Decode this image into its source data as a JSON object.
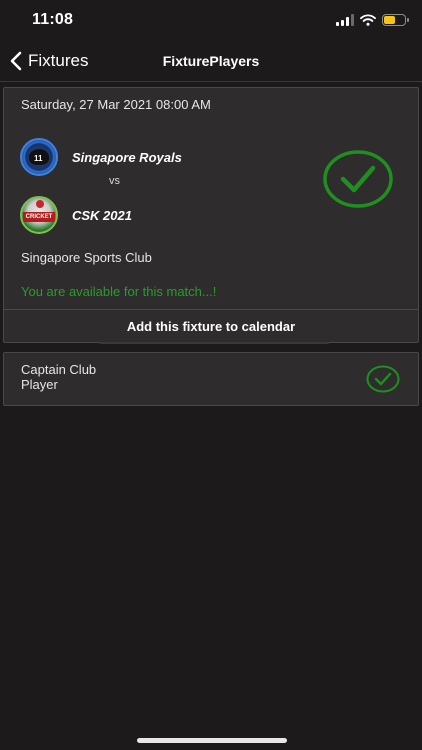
{
  "status_bar": {
    "time": "11:08",
    "icons": [
      "signal-icon",
      "wifi-icon",
      "battery-icon"
    ],
    "battery_color": "#f5c518"
  },
  "nav": {
    "back_label": "Fixtures",
    "title": "FixturePlayers"
  },
  "fixture": {
    "date_time": "Saturday, 27 Mar 2021 08:00 AM",
    "home_team": {
      "name": "Singapore Royals",
      "logo_text": "11"
    },
    "vs_label": "vs",
    "away_team": {
      "name": "CSK 2021",
      "logo_text": "CRICKET"
    },
    "venue": "Singapore Sports Club",
    "availability_text": "You are available for this match...!",
    "availability_icon": "check-circle-icon",
    "calendar_button_label": "Add this fixture to calendar"
  },
  "player": {
    "role": "Captain Club",
    "type": "Player",
    "status_icon": "check-circle-icon"
  },
  "colors": {
    "background": "#1c1a1b",
    "card": "#2e2c2d",
    "accent_green": "#2a9d2a"
  }
}
